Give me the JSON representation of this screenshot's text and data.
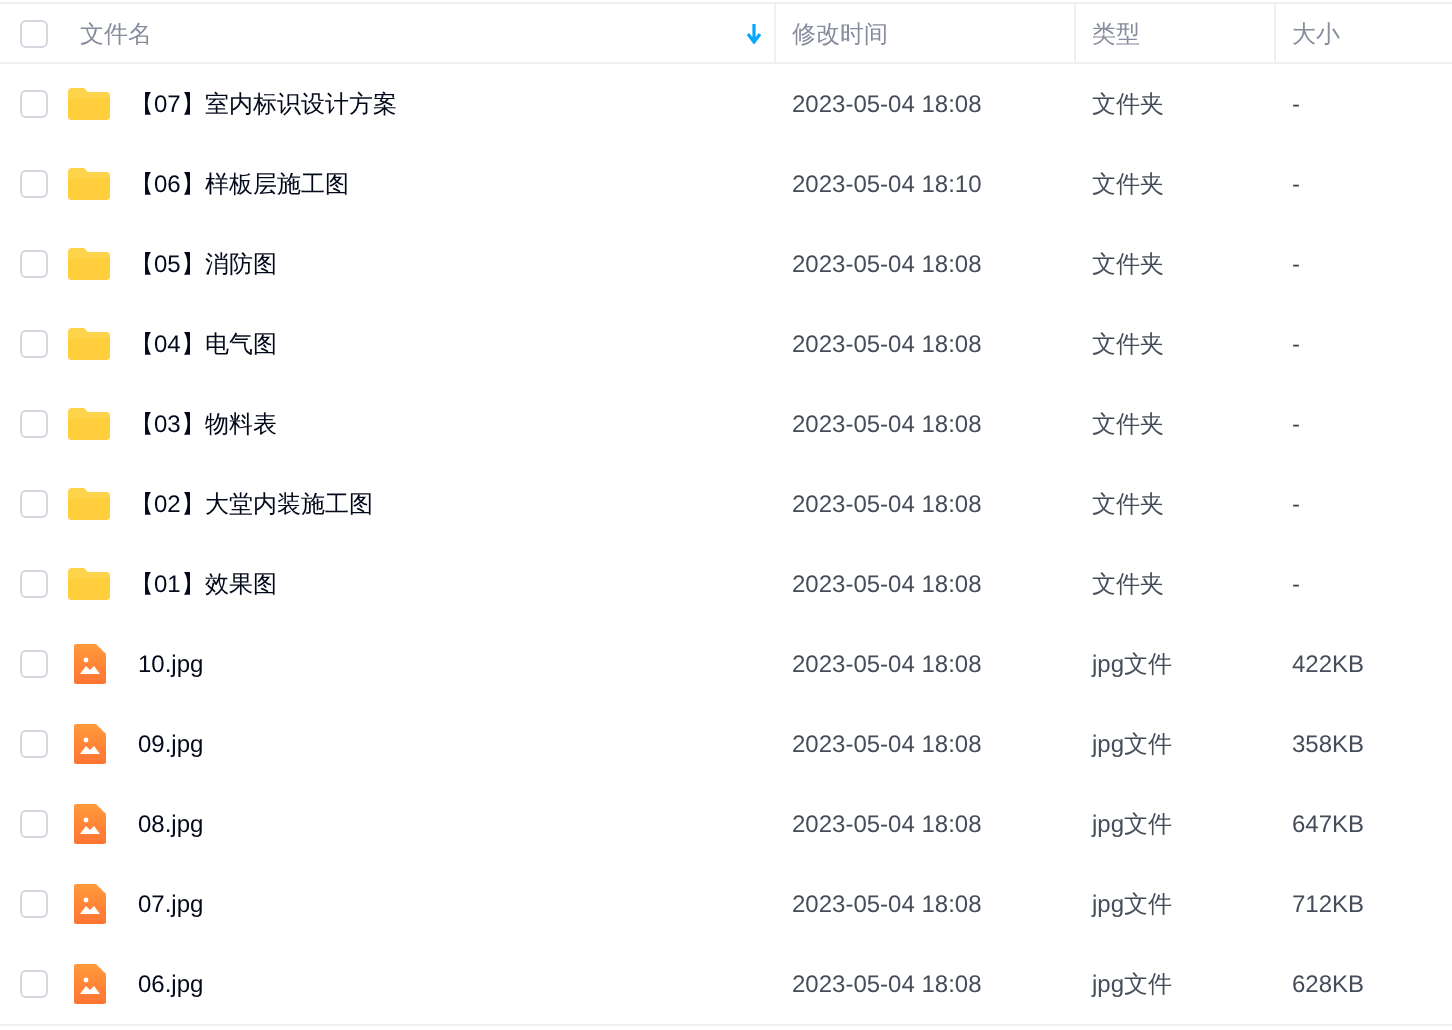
{
  "header": {
    "checked": false,
    "columns": [
      {
        "label": "文件名",
        "sorted": true
      },
      {
        "label": "修改时间",
        "sorted": false
      },
      {
        "label": "类型",
        "sorted": false
      },
      {
        "label": "大小",
        "sorted": false
      }
    ]
  },
  "rows": [
    {
      "kind": "folder",
      "name": "【07】室内标识设计方案",
      "modified": "2023-05-04 18:08",
      "type": "文件夹",
      "size": "-",
      "checked": false
    },
    {
      "kind": "folder",
      "name": "【06】样板层施工图",
      "modified": "2023-05-04 18:10",
      "type": "文件夹",
      "size": "-",
      "checked": false
    },
    {
      "kind": "folder",
      "name": "【05】消防图",
      "modified": "2023-05-04 18:08",
      "type": "文件夹",
      "size": "-",
      "checked": false
    },
    {
      "kind": "folder",
      "name": "【04】电气图",
      "modified": "2023-05-04 18:08",
      "type": "文件夹",
      "size": "-",
      "checked": false
    },
    {
      "kind": "folder",
      "name": "【03】物料表",
      "modified": "2023-05-04 18:08",
      "type": "文件夹",
      "size": "-",
      "checked": false
    },
    {
      "kind": "folder",
      "name": "【02】大堂内装施工图",
      "modified": "2023-05-04 18:08",
      "type": "文件夹",
      "size": "-",
      "checked": false
    },
    {
      "kind": "folder",
      "name": "【01】效果图",
      "modified": "2023-05-04 18:08",
      "type": "文件夹",
      "size": "-",
      "checked": false
    },
    {
      "kind": "image",
      "name": "10.jpg",
      "modified": "2023-05-04 18:08",
      "type": "jpg文件",
      "size": "422KB",
      "checked": false
    },
    {
      "kind": "image",
      "name": "09.jpg",
      "modified": "2023-05-04 18:08",
      "type": "jpg文件",
      "size": "358KB",
      "checked": false
    },
    {
      "kind": "image",
      "name": "08.jpg",
      "modified": "2023-05-04 18:08",
      "type": "jpg文件",
      "size": "647KB",
      "checked": false
    },
    {
      "kind": "image",
      "name": "07.jpg",
      "modified": "2023-05-04 18:08",
      "type": "jpg文件",
      "size": "712KB",
      "checked": false
    },
    {
      "kind": "image",
      "name": "06.jpg",
      "modified": "2023-05-04 18:08",
      "type": "jpg文件",
      "size": "628KB",
      "checked": false
    }
  ]
}
